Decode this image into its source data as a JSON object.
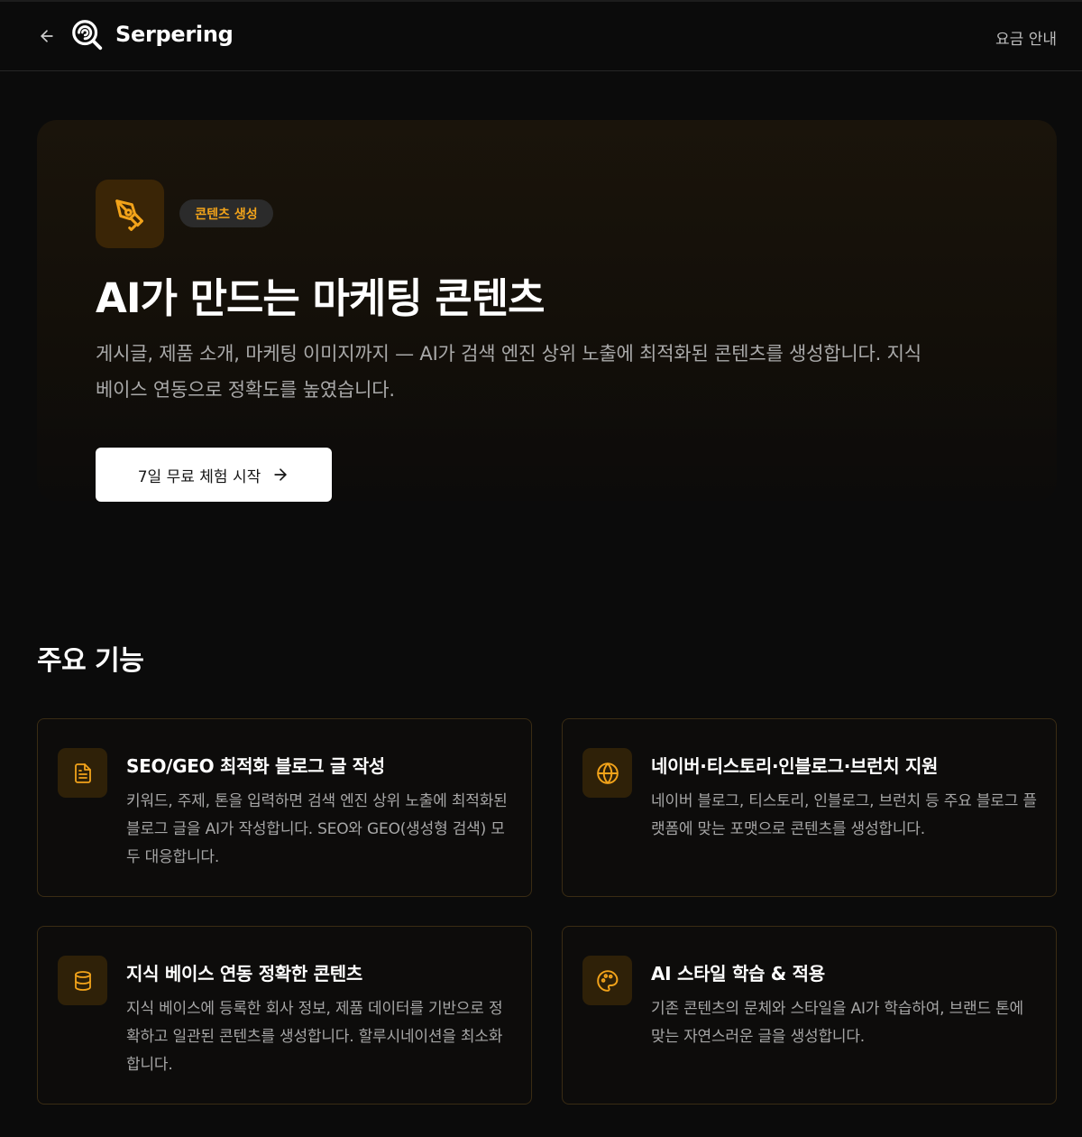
{
  "header": {
    "brand": "Serpering",
    "pricing_link": "요금 안내",
    "back_icon": "arrow-left-icon",
    "logo_icon": "serpering-logo-icon"
  },
  "hero": {
    "icon": "pen-tool-icon",
    "badge": "콘텐츠 생성",
    "title": "AI가 만드는 마케팅 콘텐츠",
    "description": "게시글, 제품 소개, 마케팅 이미지까지 — AI가 검색 엔진 상위 노출에 최적화된 콘텐츠를 생성합니다. 지식 베이스 연동으로 정확도를 높였습니다.",
    "cta_label": "7일 무료 체험 시작",
    "cta_icon": "arrow-right-icon"
  },
  "features": {
    "title": "주요 기능",
    "items": [
      {
        "icon": "document-icon",
        "title": "SEO/GEO 최적화 블로그 글 작성",
        "description": "키워드, 주제, 톤을 입력하면 검색 엔진 상위 노출에 최적화된 블로그 글을 AI가 작성합니다. SEO와 GEO(생성형 검색) 모두 대응합니다."
      },
      {
        "icon": "globe-icon",
        "title": "네이버·티스토리·인블로그·브런치 지원",
        "description": "네이버 블로그, 티스토리, 인블로그, 브런치 등 주요 블로그 플랫폼에 맞는 포맷으로 콘텐츠를 생성합니다."
      },
      {
        "icon": "database-icon",
        "title": "지식 베이스 연동 정확한 콘텐츠",
        "description": "지식 베이스에 등록한 회사 정보, 제품 데이터를 기반으로 정확하고 일관된 콘텐츠를 생성합니다. 할루시네이션을 최소화합니다."
      },
      {
        "icon": "palette-icon",
        "title": "AI 스타일 학습 & 적용",
        "description": "기존 콘텐츠의 문체와 스타일을 AI가 학습하여, 브랜드 톤에 맞는 자연스러운 글을 생성합니다."
      }
    ]
  },
  "colors": {
    "background": "#0b0b0b",
    "accent": "#f2a31a",
    "icon_bg": "#2f2108",
    "card_border": "#3a2c14"
  }
}
